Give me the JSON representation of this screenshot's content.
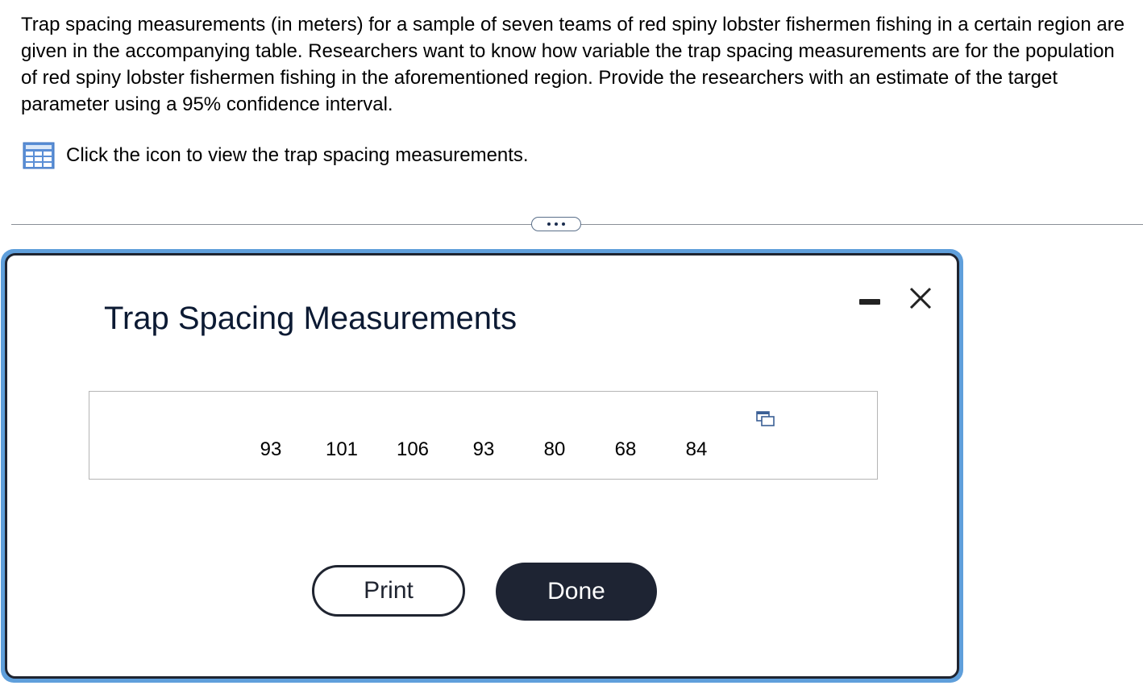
{
  "question": {
    "text": "Trap spacing measurements (in meters) for a sample of seven teams of red spiny lobster fishermen fishing in a certain region are given in the accompanying table. Researchers want to know how variable the trap spacing measurements are for the population of red spiny lobster fishermen fishing in the aforementioned region. Provide the researchers with an estimate of the target parameter using a 95% confidence interval."
  },
  "table_link": {
    "icon": "table-grid-icon",
    "text": "Click the icon to view the trap spacing measurements."
  },
  "divider": {
    "expand_icon": "ellipsis-icon"
  },
  "dialog": {
    "title": "Trap Spacing Measurements",
    "minimize_icon": "minimize-icon",
    "close_icon": "close-icon",
    "copy_icon": "copy-to-clipboard-icon",
    "values": [
      "93",
      "101",
      "106",
      "93",
      "80",
      "68",
      "84"
    ],
    "print_label": "Print",
    "done_label": "Done"
  },
  "colors": {
    "dialog_border_accent": "#5f9fdb",
    "done_button_bg": "#1e2433",
    "title_text": "#0c1a33"
  }
}
